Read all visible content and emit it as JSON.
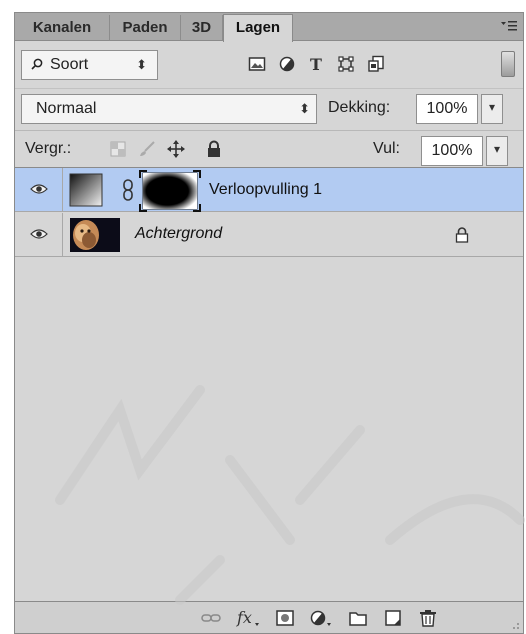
{
  "tabs": [
    {
      "label": "Kanalen",
      "active": false
    },
    {
      "label": "Paden",
      "active": false
    },
    {
      "label": "3D",
      "active": false
    },
    {
      "label": "Lagen",
      "active": true
    }
  ],
  "filter": {
    "kind_label": "Soort",
    "icons": [
      "image-filter-icon",
      "adjustment-filter-icon",
      "type-filter-icon",
      "shape-filter-icon",
      "smart-object-filter-icon"
    ]
  },
  "blend": {
    "mode": "Normaal",
    "opacity_label": "Dekking:",
    "opacity_value": "100%"
  },
  "lock": {
    "label": "Vergr.:",
    "fill_label": "Vul:",
    "fill_value": "100%"
  },
  "layers": [
    {
      "name": "Verloopvulling 1",
      "selected": true,
      "visible": true,
      "type": "gradient-fill-with-mask"
    },
    {
      "name": "Achtergrond",
      "selected": false,
      "visible": true,
      "locked": true,
      "type": "image"
    }
  ],
  "toolbar": {
    "icons": [
      "link-layers-icon",
      "fx-icon",
      "add-mask-icon",
      "new-adjustment-icon",
      "new-group-icon",
      "new-layer-icon",
      "delete-icon"
    ]
  },
  "colors": {
    "panel_bg": "#d6d6d6",
    "tabbar_bg": "#a9a9a9",
    "selected_layer": "#b2cbf2"
  }
}
